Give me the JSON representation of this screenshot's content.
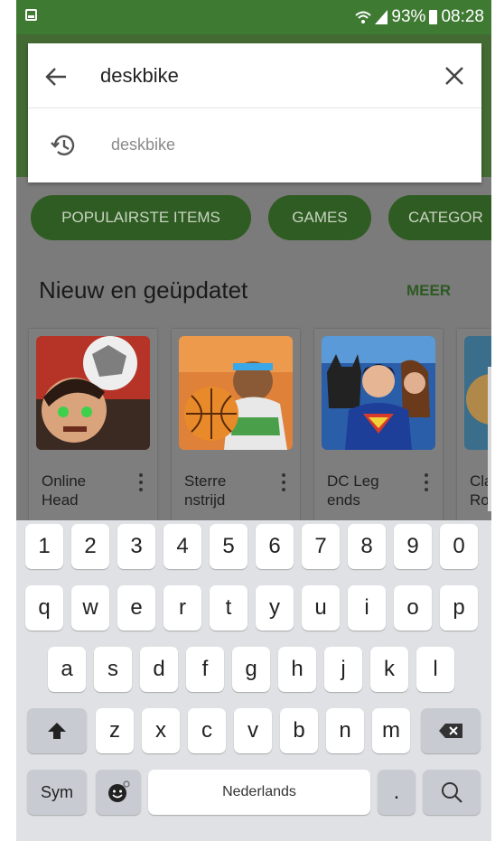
{
  "status_bar": {
    "battery": "93%",
    "time": "08:28",
    "icons": [
      "image-icon",
      "wifi-icon",
      "signal-icon",
      "battery-icon"
    ]
  },
  "search": {
    "query": "deskbike",
    "suggestions": [
      "deskbike"
    ]
  },
  "chips": [
    "POPULAIRSTE ITEMS",
    "GAMES",
    "CATEGOR"
  ],
  "section": {
    "title": "Nieuw en geüpdatet",
    "more_label": "MEER"
  },
  "apps": [
    {
      "name_line1": "Online",
      "name_line2": "Head"
    },
    {
      "name_line1": "Sterre",
      "name_line2": "nstrijd"
    },
    {
      "name_line1": "DC Leg",
      "name_line2": "ends"
    },
    {
      "name_line1": "Cla",
      "name_line2": "Ro"
    }
  ],
  "keyboard": {
    "row_numbers": [
      "1",
      "2",
      "3",
      "4",
      "5",
      "6",
      "7",
      "8",
      "9",
      "0"
    ],
    "row1": [
      "q",
      "w",
      "e",
      "r",
      "t",
      "y",
      "u",
      "i",
      "o",
      "p"
    ],
    "row2": [
      "a",
      "s",
      "d",
      "f",
      "g",
      "h",
      "j",
      "k",
      "l"
    ],
    "row3": [
      "z",
      "x",
      "c",
      "v",
      "b",
      "n",
      "m"
    ],
    "sym_label": "Sym",
    "space_label": "Nederlands",
    "period_label": "."
  },
  "colors": {
    "brand_green": "#3f7a33",
    "chip_green": "#2f5c22",
    "keyboard_bg": "#dfe1e4"
  }
}
